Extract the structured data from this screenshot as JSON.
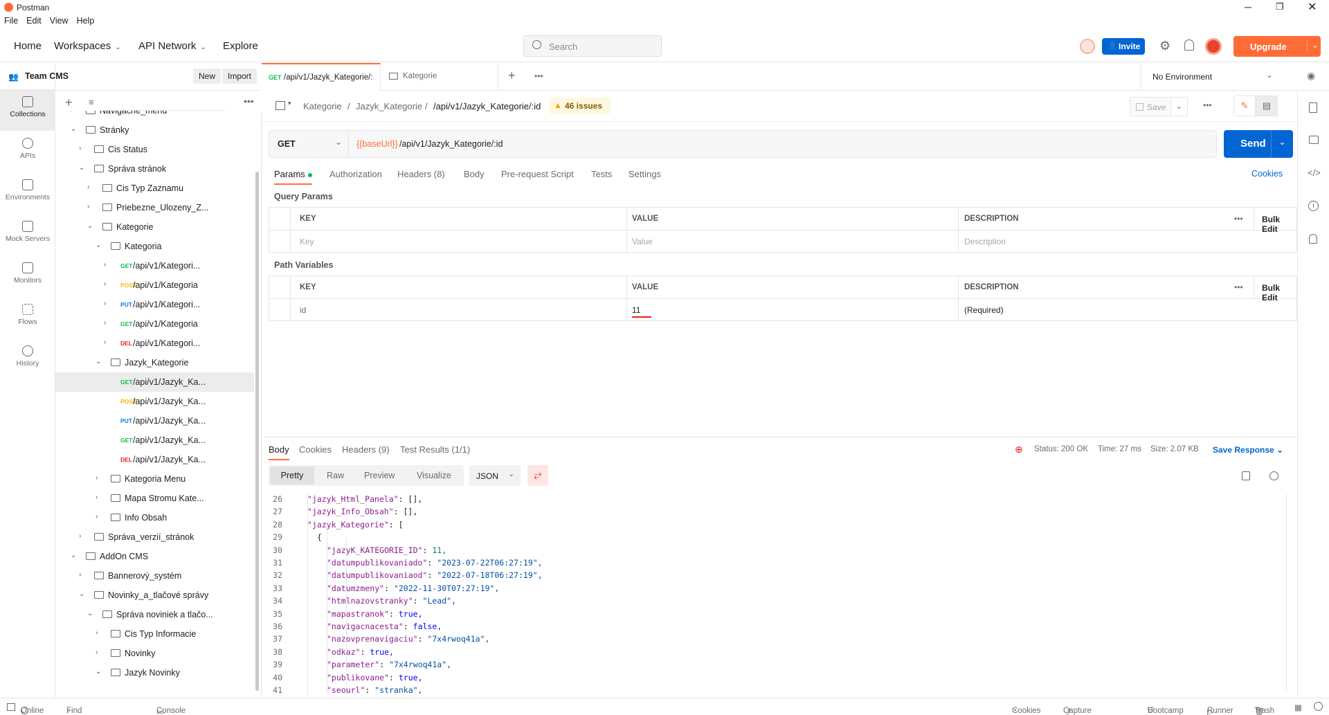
{
  "app": {
    "title": "Postman"
  },
  "menu": [
    "File",
    "Edit",
    "View",
    "Help"
  ],
  "topnav": {
    "home": "Home",
    "workspaces": "Workspaces",
    "api_network": "API Network",
    "explore": "Explore",
    "search_placeholder": "Search",
    "invite": "Invite",
    "upgrade": "Upgrade"
  },
  "rail": {
    "items": [
      "Collections",
      "APIs",
      "Environments",
      "Mock Servers",
      "Monitors",
      "Flows",
      "History"
    ]
  },
  "sidebar": {
    "team": "Team CMS",
    "new_btn": "New",
    "import_btn": "Import",
    "tree": [
      {
        "label": "Navigacne_menu",
        "kind": "folder",
        "arrow": "›"
      },
      {
        "label": "Stránky",
        "kind": "folder",
        "arrow": "⌄"
      },
      {
        "label": "Cis Status",
        "kind": "folder",
        "arrow": "›"
      },
      {
        "label": "Správa stránok",
        "kind": "folder",
        "arrow": "⌄"
      },
      {
        "label": "Cis Typ Zaznamu",
        "kind": "folder",
        "arrow": "›"
      },
      {
        "label": "Priebezne_Ulozeny_Z...",
        "kind": "folder",
        "arrow": "›"
      },
      {
        "label": "Kategorie",
        "kind": "folder",
        "arrow": "⌄"
      },
      {
        "label": "Kategoria",
        "kind": "folder",
        "arrow": "⌄"
      },
      {
        "label": "/api/v1/Kategori...",
        "kind": "request",
        "method": "GET",
        "arrow": "›"
      },
      {
        "label": "/api/v1/Kategoria",
        "kind": "request",
        "method": "POST",
        "arrow": "›"
      },
      {
        "label": "/api/v1/Kategori...",
        "kind": "request",
        "method": "PUT",
        "arrow": "›"
      },
      {
        "label": "/api/v1/Kategoria",
        "kind": "request",
        "method": "GET",
        "arrow": "›"
      },
      {
        "label": "/api/v1/Kategori...",
        "kind": "request",
        "method": "DEL",
        "arrow": "›"
      },
      {
        "label": "Jazyk_Kategorie",
        "kind": "folder",
        "arrow": "⌄"
      },
      {
        "label": "/api/v1/Jazyk_Ka...",
        "kind": "request",
        "method": "GET",
        "arrow": ""
      },
      {
        "label": "/api/v1/Jazyk_Ka...",
        "kind": "request",
        "method": "POST",
        "arrow": ""
      },
      {
        "label": "/api/v1/Jazyk_Ka...",
        "kind": "request",
        "method": "PUT",
        "arrow": ""
      },
      {
        "label": "/api/v1/Jazyk_Ka...",
        "kind": "request",
        "method": "GET",
        "arrow": ""
      },
      {
        "label": "/api/v1/Jazyk_Ka...",
        "kind": "request",
        "method": "DEL",
        "arrow": ""
      },
      {
        "label": "Kategoria Menu",
        "kind": "folder",
        "arrow": "›"
      },
      {
        "label": "Mapa Stromu Kate...",
        "kind": "folder",
        "arrow": "›"
      },
      {
        "label": "Info Obsah",
        "kind": "folder",
        "arrow": "›"
      },
      {
        "label": "Správa_verzií_stránok",
        "kind": "folder",
        "arrow": "›"
      },
      {
        "label": "AddOn CMS",
        "kind": "folder",
        "arrow": "⌄"
      },
      {
        "label": "Bannerový_systém",
        "kind": "folder",
        "arrow": "›"
      },
      {
        "label": "Novinky_a_tlačové správy",
        "kind": "folder",
        "arrow": "⌄"
      },
      {
        "label": "Správa noviniek a tlačo...",
        "kind": "folder",
        "arrow": "⌄"
      },
      {
        "label": "Cis Typ Informacie",
        "kind": "folder",
        "arrow": "›"
      },
      {
        "label": "Novinky",
        "kind": "folder",
        "arrow": "›"
      },
      {
        "label": "Jazyk Novinky",
        "kind": "folder",
        "arrow": "⌄"
      }
    ]
  },
  "tabs": [
    {
      "method": "GET",
      "label": "/api/v1/Jazyk_Kategorie/:"
    },
    {
      "method": "",
      "label": "Kategorie"
    }
  ],
  "environment": "No Environment",
  "breadcrumb": {
    "part1": "Kategorie",
    "part2": "Jazyk_Kategorie",
    "part3": "/api/v1/Jazyk_Kategorie/:id",
    "issues": "46 issues",
    "save": "Save"
  },
  "request": {
    "method": "GET",
    "url_var": "{{baseUrl}}",
    "url_path": "/api/v1/Jazyk_Kategorie/:id",
    "send": "Send"
  },
  "req_tabs": [
    "Params",
    "Authorization",
    "Headers (8)",
    "Body",
    "Pre-request Script",
    "Tests",
    "Settings"
  ],
  "cookies": "Cookies",
  "query_params": {
    "title": "Query Params",
    "headers": [
      "KEY",
      "VALUE",
      "DESCRIPTION"
    ],
    "bulk": "Bulk Edit",
    "placeholder": [
      "Key",
      "Value",
      "Description"
    ]
  },
  "path_vars": {
    "title": "Path Variables",
    "headers": [
      "KEY",
      "VALUE",
      "DESCRIPTION"
    ],
    "bulk": "Bulk Edit",
    "row": [
      "id",
      "11",
      "(Required)"
    ]
  },
  "response": {
    "tabs": [
      "Body",
      "Cookies",
      "Headers (9)",
      "Test Results (1/1)"
    ],
    "status": "Status: 200 OK",
    "time": "Time: 27 ms",
    "size": "Size: 2.07 KB",
    "save": "Save Response",
    "view_tabs": [
      "Pretty",
      "Raw",
      "Preview",
      "Visualize"
    ],
    "format": "JSON"
  },
  "code": [
    {
      "n": "26",
      "indent": 2,
      "key": "\"jazyk_Html_Panela\"",
      "val": "[],",
      "vt": "p"
    },
    {
      "n": "27",
      "indent": 2,
      "key": "\"jazyk_Info_Obsah\"",
      "val": "[],",
      "vt": "p"
    },
    {
      "n": "28",
      "indent": 2,
      "key": "\"jazyk_Kategorie\"",
      "val": "[",
      "vt": "p"
    },
    {
      "n": "29",
      "indent": 3,
      "key": "",
      "val": "{",
      "vt": "p"
    },
    {
      "n": "30",
      "indent": 4,
      "key": "\"jazyK_KATEGORIE_ID\"",
      "val": "11,",
      "vt": "n"
    },
    {
      "n": "31",
      "indent": 4,
      "key": "\"datumpublikovaniado\"",
      "val": "\"2023-07-22T06:27:19\",",
      "vt": "s"
    },
    {
      "n": "32",
      "indent": 4,
      "key": "\"datumpublikovaniaod\"",
      "val": "\"2022-07-18T06:27:19\",",
      "vt": "s"
    },
    {
      "n": "33",
      "indent": 4,
      "key": "\"datumzmeny\"",
      "val": "\"2022-11-30T07:27:19\",",
      "vt": "s"
    },
    {
      "n": "34",
      "indent": 4,
      "key": "\"htmlnazovstranky\"",
      "val": "\"Lead\",",
      "vt": "s"
    },
    {
      "n": "35",
      "indent": 4,
      "key": "\"mapastranok\"",
      "val": "true,",
      "vt": "b"
    },
    {
      "n": "36",
      "indent": 4,
      "key": "\"navigacnacesta\"",
      "val": "false,",
      "vt": "b"
    },
    {
      "n": "37",
      "indent": 4,
      "key": "\"nazovprenavigaciu\"",
      "val": "\"7x4rwoq41a\",",
      "vt": "s"
    },
    {
      "n": "38",
      "indent": 4,
      "key": "\"odkaz\"",
      "val": "true,",
      "vt": "b"
    },
    {
      "n": "39",
      "indent": 4,
      "key": "\"parameter\"",
      "val": "\"7x4rwoq41a\",",
      "vt": "s"
    },
    {
      "n": "40",
      "indent": 4,
      "key": "\"publikovane\"",
      "val": "true,",
      "vt": "b"
    },
    {
      "n": "41",
      "indent": 4,
      "key": "\"seourl\"",
      "val": "\"stranka\",",
      "vt": "s"
    }
  ],
  "statusbar": {
    "online": "Online",
    "find": "Find and Replace",
    "console": "Console",
    "cookies": "Cookies",
    "capture": "Capture requests",
    "bootcamp": "Bootcamp",
    "runner": "Runner",
    "trash": "Trash"
  },
  "colors": {
    "accent": "#ff6c37",
    "blue": "#0265d2",
    "get": "#0cbb52",
    "post": "#ffb400",
    "put": "#097bed",
    "del": "#eb2013"
  }
}
